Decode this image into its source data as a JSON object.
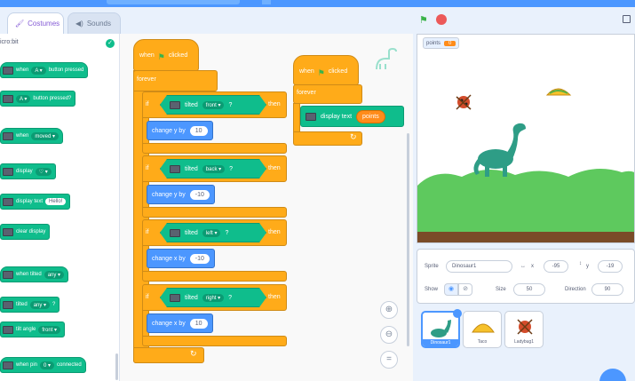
{
  "tabs": {
    "costumes": "Costumes",
    "sounds": "Sounds"
  },
  "palette": {
    "title": "icro:bit",
    "blocks": [
      {
        "id": "b1",
        "parts": [
          {
            "t": "text",
            "v": "when"
          },
          {
            "t": "dd",
            "v": "A ▾"
          },
          {
            "t": "text",
            "v": "button pressed"
          }
        ]
      },
      {
        "id": "b2",
        "parts": [
          {
            "t": "dd",
            "v": "A ▾"
          },
          {
            "t": "text",
            "v": "button pressed?"
          }
        ]
      },
      {
        "id": "b3",
        "parts": [
          {
            "t": "text",
            "v": "when"
          },
          {
            "t": "dd",
            "v": "moved ▾"
          }
        ]
      },
      {
        "id": "b4",
        "parts": [
          {
            "t": "text",
            "v": "display"
          },
          {
            "t": "dd",
            "v": "♡ ▾"
          }
        ]
      },
      {
        "id": "b5",
        "parts": [
          {
            "t": "text",
            "v": "display text"
          },
          {
            "t": "pill",
            "v": "Hello!"
          }
        ]
      },
      {
        "id": "b6",
        "parts": [
          {
            "t": "text",
            "v": "clear display"
          }
        ]
      },
      {
        "id": "b7",
        "parts": [
          {
            "t": "text",
            "v": "when tilted"
          },
          {
            "t": "dd",
            "v": "any ▾"
          }
        ]
      },
      {
        "id": "b8",
        "parts": [
          {
            "t": "text",
            "v": "tilted"
          },
          {
            "t": "dd",
            "v": "any ▾"
          },
          {
            "t": "text",
            "v": "?"
          }
        ]
      },
      {
        "id": "b9",
        "parts": [
          {
            "t": "text",
            "v": "tilt angle"
          },
          {
            "t": "dd",
            "v": "front ▾"
          }
        ]
      },
      {
        "id": "b10",
        "parts": [
          {
            "t": "text",
            "v": "when pin"
          },
          {
            "t": "dd",
            "v": "0 ▾"
          },
          {
            "t": "text",
            "v": "connected"
          }
        ]
      }
    ]
  },
  "script1": {
    "hat_when": "when",
    "hat_clicked": "clicked",
    "forever": "forever",
    "if": "if",
    "then": "then",
    "tilted": "tilted",
    "q": "?",
    "rows": [
      {
        "dir": "front ▾",
        "action": "change y by",
        "value": "10"
      },
      {
        "dir": "back ▾",
        "action": "change y by",
        "value": "-10"
      },
      {
        "dir": "left ▾",
        "action": "change x by",
        "value": "-10"
      },
      {
        "dir": "right ▾",
        "action": "change x by",
        "value": "10"
      }
    ]
  },
  "script2": {
    "hat_when": "when",
    "hat_clicked": "clicked",
    "forever": "forever",
    "display_text": "display text",
    "var": "points"
  },
  "stage": {
    "monitor_label": "points",
    "monitor_value": "0"
  },
  "sprite_info": {
    "sprite_label": "Sprite",
    "sprite_name": "Dinosaur1",
    "x_label": "x",
    "x_value": "-95",
    "y_label": "y",
    "y_value": "-19",
    "show_label": "Show",
    "size_label": "Size",
    "size_value": "50",
    "direction_label": "Direction",
    "direction_value": "90"
  },
  "sprites": [
    {
      "name": "Dinosaur1",
      "selected": true
    },
    {
      "name": "Taco",
      "selected": false
    },
    {
      "name": "Ladybug1",
      "selected": false
    }
  ],
  "colors": {
    "events": "#ffab19",
    "microbit": "#0fbd8c",
    "motion": "#4c97ff",
    "variables": "#ff8c1a",
    "accent": "#855cd6"
  }
}
